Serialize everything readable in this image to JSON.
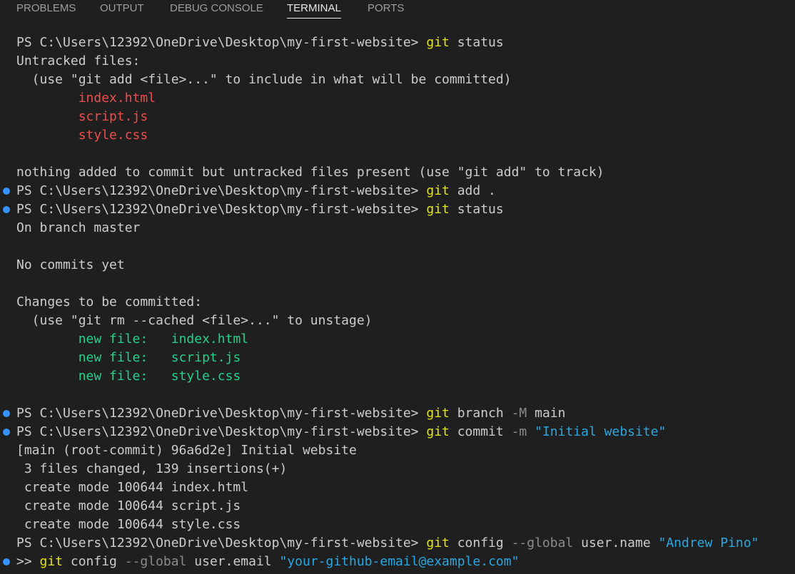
{
  "panel": {
    "tabs": [
      {
        "label": "PROBLEMS",
        "active": false
      },
      {
        "label": "OUTPUT",
        "active": false
      },
      {
        "label": "DEBUG CONSOLE",
        "active": false
      },
      {
        "label": "TERMINAL",
        "active": true
      },
      {
        "label": "PORTS",
        "active": false
      }
    ]
  },
  "colors": {
    "background": "#1f1f1f",
    "text": "#cccccc",
    "command": "#e5e510",
    "flag": "#8b8b8b",
    "string": "#2aa7e0",
    "untracked": "#f14c4c",
    "staged": "#23d18b",
    "decoration": "#3794ff"
  },
  "terminal": {
    "lines": [
      {
        "marker": false,
        "segments": [
          {
            "t": "PS C:\\Users\\12392\\OneDrive\\Desktop\\my-first-website> ",
            "c": ""
          },
          {
            "t": "git",
            "c": "cmd"
          },
          {
            "t": " status",
            "c": ""
          }
        ]
      },
      {
        "marker": false,
        "segments": [
          {
            "t": "Untracked files:",
            "c": ""
          }
        ]
      },
      {
        "marker": false,
        "segments": [
          {
            "t": "  (use \"git add <file>...\" to include in what will be committed)",
            "c": ""
          }
        ]
      },
      {
        "marker": false,
        "segments": [
          {
            "t": "        ",
            "c": ""
          },
          {
            "t": "index.html",
            "c": "red"
          }
        ]
      },
      {
        "marker": false,
        "segments": [
          {
            "t": "        ",
            "c": ""
          },
          {
            "t": "script.js",
            "c": "red"
          }
        ]
      },
      {
        "marker": false,
        "segments": [
          {
            "t": "        ",
            "c": ""
          },
          {
            "t": "style.css",
            "c": "red"
          }
        ]
      },
      {
        "marker": false,
        "segments": [
          {
            "t": "",
            "c": ""
          }
        ]
      },
      {
        "marker": false,
        "segments": [
          {
            "t": "nothing added to commit but untracked files present (use \"git add\" to track)",
            "c": ""
          }
        ]
      },
      {
        "marker": true,
        "segments": [
          {
            "t": "PS C:\\Users\\12392\\OneDrive\\Desktop\\my-first-website> ",
            "c": ""
          },
          {
            "t": "git",
            "c": "cmd"
          },
          {
            "t": " add .",
            "c": ""
          }
        ]
      },
      {
        "marker": true,
        "segments": [
          {
            "t": "PS C:\\Users\\12392\\OneDrive\\Desktop\\my-first-website> ",
            "c": ""
          },
          {
            "t": "git",
            "c": "cmd"
          },
          {
            "t": " status",
            "c": ""
          }
        ]
      },
      {
        "marker": false,
        "segments": [
          {
            "t": "On branch master",
            "c": ""
          }
        ]
      },
      {
        "marker": false,
        "segments": [
          {
            "t": "",
            "c": ""
          }
        ]
      },
      {
        "marker": false,
        "segments": [
          {
            "t": "No commits yet",
            "c": ""
          }
        ]
      },
      {
        "marker": false,
        "segments": [
          {
            "t": "",
            "c": ""
          }
        ]
      },
      {
        "marker": false,
        "segments": [
          {
            "t": "Changes to be committed:",
            "c": ""
          }
        ]
      },
      {
        "marker": false,
        "segments": [
          {
            "t": "  (use \"git rm --cached <file>...\" to unstage)",
            "c": ""
          }
        ]
      },
      {
        "marker": false,
        "segments": [
          {
            "t": "        ",
            "c": ""
          },
          {
            "t": "new file:   index.html",
            "c": "green"
          }
        ]
      },
      {
        "marker": false,
        "segments": [
          {
            "t": "        ",
            "c": ""
          },
          {
            "t": "new file:   script.js",
            "c": "green"
          }
        ]
      },
      {
        "marker": false,
        "segments": [
          {
            "t": "        ",
            "c": ""
          },
          {
            "t": "new file:   style.css",
            "c": "green"
          }
        ]
      },
      {
        "marker": false,
        "segments": [
          {
            "t": "",
            "c": ""
          }
        ]
      },
      {
        "marker": true,
        "segments": [
          {
            "t": "PS C:\\Users\\12392\\OneDrive\\Desktop\\my-first-website> ",
            "c": ""
          },
          {
            "t": "git",
            "c": "cmd"
          },
          {
            "t": " branch ",
            "c": ""
          },
          {
            "t": "-M",
            "c": "flag"
          },
          {
            "t": " main",
            "c": ""
          }
        ]
      },
      {
        "marker": true,
        "segments": [
          {
            "t": "PS C:\\Users\\12392\\OneDrive\\Desktop\\my-first-website> ",
            "c": ""
          },
          {
            "t": "git",
            "c": "cmd"
          },
          {
            "t": " commit ",
            "c": ""
          },
          {
            "t": "-m",
            "c": "flag"
          },
          {
            "t": " ",
            "c": ""
          },
          {
            "t": "\"Initial website\"",
            "c": "str"
          }
        ]
      },
      {
        "marker": false,
        "segments": [
          {
            "t": "[main (root-commit) 96a6d2e] Initial website",
            "c": ""
          }
        ]
      },
      {
        "marker": false,
        "segments": [
          {
            "t": " 3 files changed, 139 insertions(+)",
            "c": ""
          }
        ]
      },
      {
        "marker": false,
        "segments": [
          {
            "t": " create mode 100644 index.html",
            "c": ""
          }
        ]
      },
      {
        "marker": false,
        "segments": [
          {
            "t": " create mode 100644 script.js",
            "c": ""
          }
        ]
      },
      {
        "marker": false,
        "segments": [
          {
            "t": " create mode 100644 style.css",
            "c": ""
          }
        ]
      },
      {
        "marker": false,
        "segments": [
          {
            "t": "PS C:\\Users\\12392\\OneDrive\\Desktop\\my-first-website> ",
            "c": ""
          },
          {
            "t": "git",
            "c": "cmd"
          },
          {
            "t": " config ",
            "c": ""
          },
          {
            "t": "--global",
            "c": "flag"
          },
          {
            "t": " user.name ",
            "c": ""
          },
          {
            "t": "\"Andrew Pino\"",
            "c": "str"
          }
        ]
      },
      {
        "marker": true,
        "segments": [
          {
            "t": ">> ",
            "c": ""
          },
          {
            "t": "git",
            "c": "cmd"
          },
          {
            "t": " config ",
            "c": ""
          },
          {
            "t": "--global",
            "c": "flag"
          },
          {
            "t": " user.email ",
            "c": ""
          },
          {
            "t": "\"your-github-email@example.com\"",
            "c": "str"
          }
        ]
      }
    ]
  }
}
